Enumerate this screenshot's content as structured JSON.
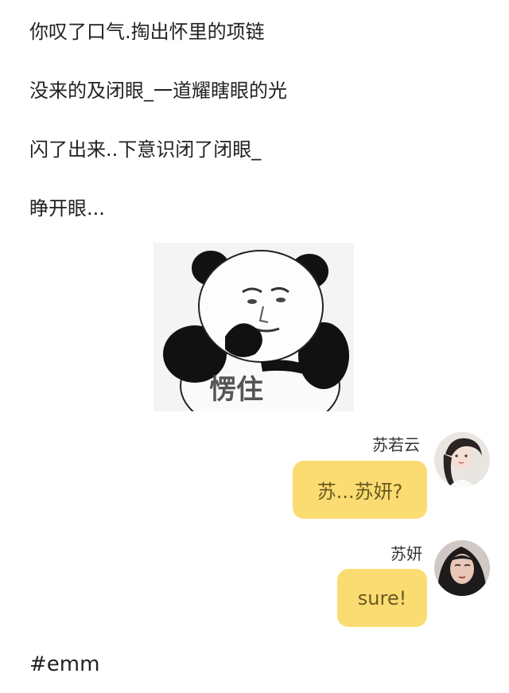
{
  "story": {
    "lines": [
      "你叹了口气.掏出怀里的项链",
      "没来的及闭眼_一道耀瞎眼的光",
      "闪了出来..下意识闭了闭眼_",
      "睁开眼..."
    ]
  },
  "meme": {
    "caption": "愣住"
  },
  "chat": {
    "messages": [
      {
        "speaker": "苏若云",
        "text": "苏...苏妍?"
      },
      {
        "speaker": "苏妍",
        "text": "sure!"
      }
    ]
  },
  "hashtag": "#emm",
  "colors": {
    "bubble": "#fbdc72",
    "bubble_text": "#6b5a20",
    "text": "#222222"
  }
}
